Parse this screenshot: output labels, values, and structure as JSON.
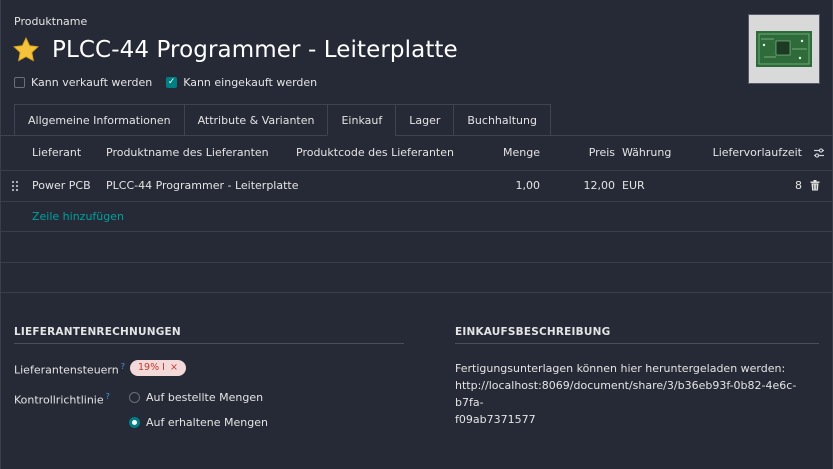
{
  "header": {
    "field_label": "Produktname",
    "title": "PLCC-44 Programmer - Leiterplatte",
    "star_icon": "star-icon",
    "can_be_sold_label": "Kann verkauft werden",
    "can_be_sold": false,
    "can_be_purchased_label": "Kann eingekauft werden",
    "can_be_purchased": true
  },
  "tabs": [
    {
      "label": "Allgemeine Informationen"
    },
    {
      "label": "Attribute & Varianten"
    },
    {
      "label": "Einkauf",
      "active": true
    },
    {
      "label": "Lager"
    },
    {
      "label": "Buchhaltung"
    }
  ],
  "table": {
    "columns": {
      "vendor": "Lieferant",
      "vendor_product_name": "Produktname des Lieferanten",
      "vendor_product_code": "Produktcode des Lieferanten",
      "quantity": "Menge",
      "price": "Preis",
      "currency": "Währung",
      "lead_time": "Liefervorlaufzeit"
    },
    "rows": [
      {
        "vendor": "Power PCB",
        "vendor_product_name": "PLCC-44 Programmer - Leiterplatte",
        "vendor_product_code": "",
        "quantity": "1,00",
        "price": "12,00",
        "currency": "EUR",
        "lead_time": "8"
      }
    ],
    "add_line": "Zeile hinzufügen"
  },
  "vendor_bills": {
    "title": "LIEFERANTENRECHNUNGEN",
    "taxes_label": "Lieferantensteuern",
    "taxes_tag": "19% I",
    "control_policy_label": "Kontrollrichtlinie",
    "help_marker": "?",
    "options": [
      {
        "label": "Auf bestellte Mengen",
        "selected": false
      },
      {
        "label": "Auf erhaltene Mengen",
        "selected": true
      }
    ]
  },
  "purchase_description": {
    "title": "EINKAUFSBESCHREIBUNG",
    "line1": "Fertigungsunterlagen können hier heruntergeladen werden:",
    "line2": "http://localhost:8069/document/share/3/b36eb93f-0b82-4e6c-b7fa-",
    "line3": "f09ab7371577"
  },
  "colors": {
    "accent": "#017e84",
    "link": "#00a09d",
    "background": "#262a36",
    "tag_bg": "#f3d9d9",
    "tag_text": "#c0392b"
  }
}
